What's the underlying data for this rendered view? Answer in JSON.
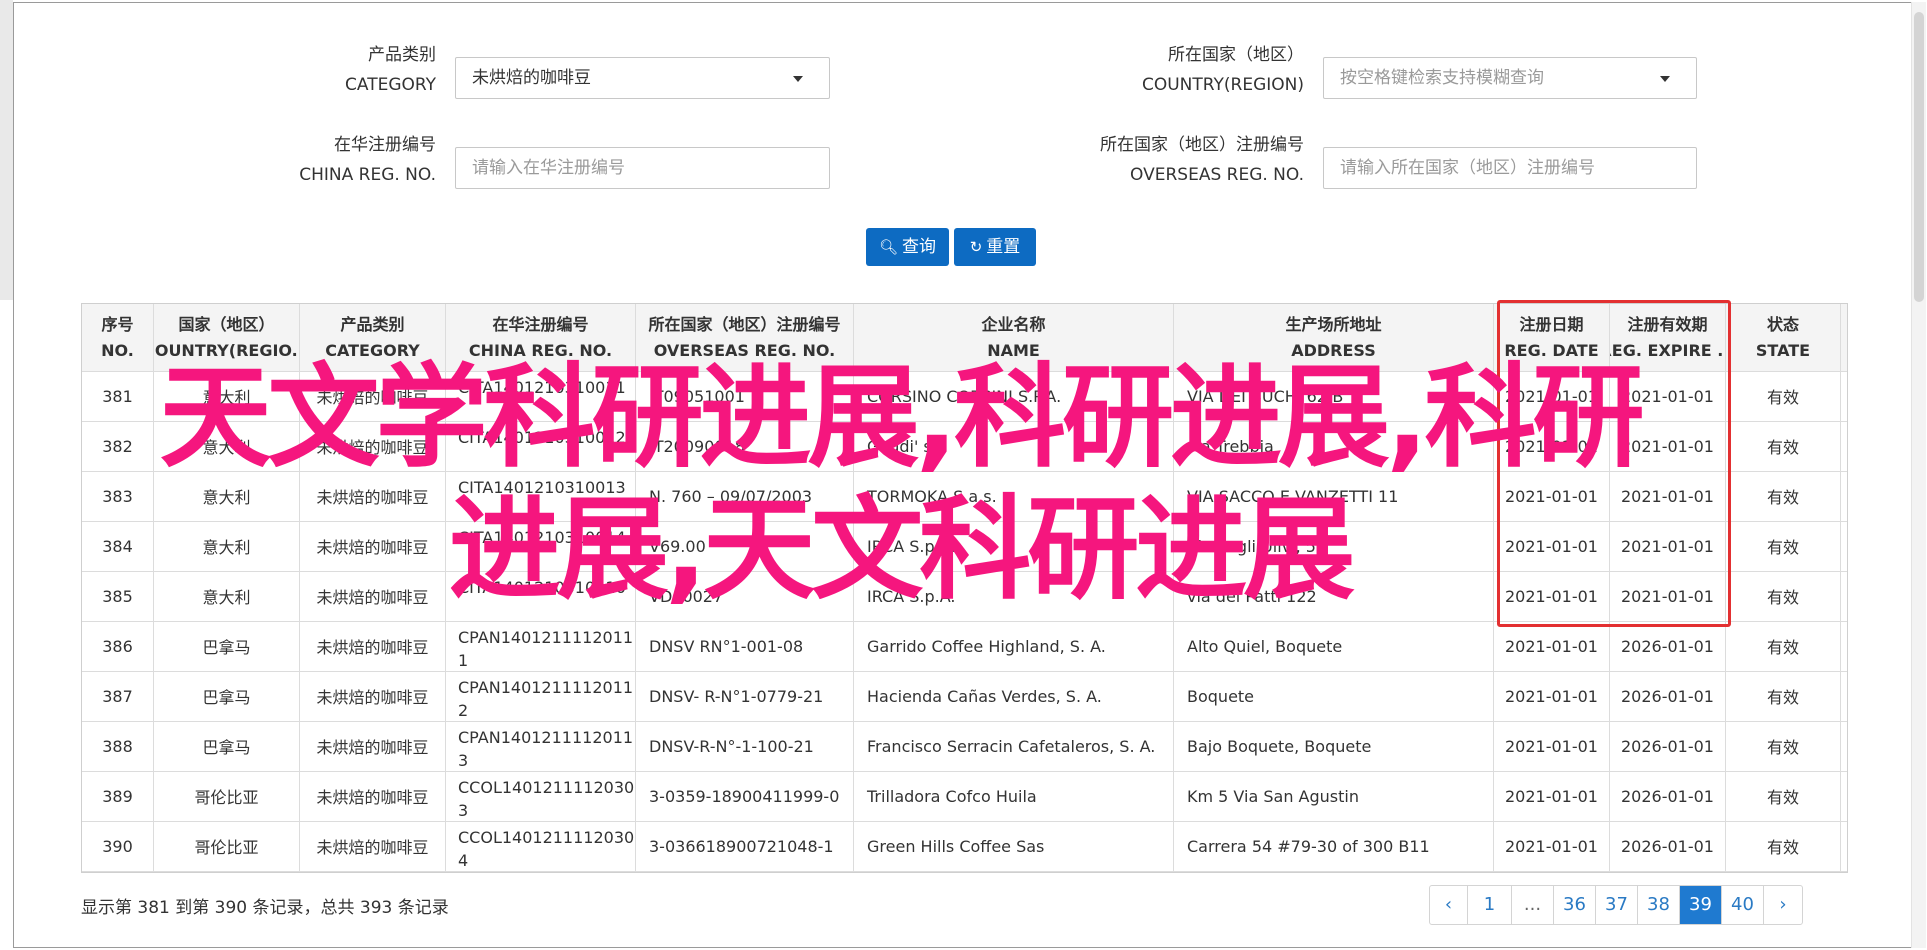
{
  "filters": {
    "category": {
      "label_cn": "产品类别",
      "label_en": "CATEGORY",
      "value": "未烘焙的咖啡豆"
    },
    "country": {
      "label_cn": "所在国家（地区）",
      "label_en": "COUNTRY(REGION)",
      "placeholder": "按空格键检索支持模糊查询"
    },
    "china_reg": {
      "label_cn": "在华注册编号",
      "label_en": "CHINA REG. NO.",
      "placeholder": "请输入在华注册编号"
    },
    "overseas_reg": {
      "label_cn": "所在国家（地区）注册编号",
      "label_en": "OVERSEAS REG. NO.",
      "placeholder": "请输入所在国家（地区）注册编号"
    },
    "search_button": "查询",
    "reset_button": "重置"
  },
  "table": {
    "headers": [
      {
        "cn": "序号",
        "en": "NO."
      },
      {
        "cn": "国家（地区）",
        "en": "COUNTRY(REGIO..."
      },
      {
        "cn": "产品类别",
        "en": "CATEGORY"
      },
      {
        "cn": "在华注册编号",
        "en": "CHINA REG. NO."
      },
      {
        "cn": "所在国家（地区）注册编号",
        "en": "OVERSEAS REG. NO."
      },
      {
        "cn": "企业名称",
        "en": "NAME"
      },
      {
        "cn": "生产场所地址",
        "en": "ADDRESS"
      },
      {
        "cn": "注册日期",
        "en": "REG. DATE"
      },
      {
        "cn": "注册有效期",
        "en": "REG. EXPIRE ..."
      },
      {
        "cn": "状态",
        "en": "STATE"
      }
    ],
    "rows": [
      {
        "no": "381",
        "country": "意大利",
        "category": "未烘焙的咖啡豆",
        "china_reg": "CITA1401210310011",
        "overseas_reg": "IT09051001",
        "name": "CORSINO CORSINI S.P.A.",
        "address": "VIA DEI BUCHI 62/B",
        "reg_date": "2021-01-01",
        "expire": "2021-01-01",
        "state": "有效"
      },
      {
        "no": "382",
        "country": "意大利",
        "category": "未烘焙的咖啡豆",
        "china_reg": "CITA1401210310012",
        "overseas_reg": "IT20090018",
        "name": "Gaudi' srl",
        "address": "via Trebbia",
        "reg_date": "2021-01-01",
        "expire": "2021-01-01",
        "state": "有效"
      },
      {
        "no": "383",
        "country": "意大利",
        "category": "未烘焙的咖啡豆",
        "china_reg": "CITA1401210310013",
        "overseas_reg": "N. 760 – 09/07/2003",
        "name": "TORMOKA S.a.s.",
        "address": "VIA SACCO E VANZETTI 11",
        "reg_date": "2021-01-01",
        "expire": "2021-01-01",
        "state": "有效"
      },
      {
        "no": "384",
        "country": "意大利",
        "category": "未烘焙的咖啡豆",
        "china_reg": "CITA1401210310014",
        "overseas_reg": "V69.00",
        "name": "IRCA S.p.A.",
        "address": "Via degli Ulivi, 5",
        "reg_date": "2021-01-01",
        "expire": "2021-01-01",
        "state": "有效"
      },
      {
        "no": "385",
        "country": "意大利",
        "category": "未烘焙的咖啡豆",
        "china_reg": "CITA1401210310016",
        "overseas_reg": "VD00027",
        "name": "IRCA S.p.A.",
        "address": "via dei Patti 122",
        "reg_date": "2021-01-01",
        "expire": "2021-01-01",
        "state": "有效"
      },
      {
        "no": "386",
        "country": "巴拿马",
        "category": "未烘焙的咖啡豆",
        "china_reg": "CPAN14012111120111",
        "overseas_reg": "DNSV RN°1-001-08",
        "name": "Garrido Coffee Highland, S. A.",
        "address": "Alto Quiel, Boquete",
        "reg_date": "2021-01-01",
        "expire": "2026-01-01",
        "state": "有效"
      },
      {
        "no": "387",
        "country": "巴拿马",
        "category": "未烘焙的咖啡豆",
        "china_reg": "CPAN14012111120112",
        "overseas_reg": "DNSV- R-N°1-0779-21",
        "name": "Hacienda Cañas Verdes, S. A.",
        "address": "Boquete",
        "reg_date": "2021-01-01",
        "expire": "2026-01-01",
        "state": "有效"
      },
      {
        "no": "388",
        "country": "巴拿马",
        "category": "未烘焙的咖啡豆",
        "china_reg": "CPAN14012111120113",
        "overseas_reg": "DNSV-R-N°-1-100-21",
        "name": "Francisco Serracin Cafetaleros, S. A.",
        "address": "Bajo Boquete, Boquete",
        "reg_date": "2021-01-01",
        "expire": "2026-01-01",
        "state": "有效"
      },
      {
        "no": "389",
        "country": "哥伦比亚",
        "category": "未烘焙的咖啡豆",
        "china_reg": "CCOL14012111120303",
        "overseas_reg": "3-0359-18900411999-0",
        "name": "Trilladora Cofco Huila",
        "address": "Km 5 Via San Agustin",
        "reg_date": "2021-01-01",
        "expire": "2026-01-01",
        "state": "有效"
      },
      {
        "no": "390",
        "country": "哥伦比亚",
        "category": "未烘焙的咖啡豆",
        "china_reg": "CCOL14012111120304",
        "overseas_reg": "3-036618900721048-1",
        "name": "Green Hills Coffee Sas",
        "address": "Carrera 54 #79-30 of 300 B11",
        "reg_date": "2021-01-01",
        "expire": "2026-01-01",
        "state": "有效"
      }
    ]
  },
  "overlay_text": "天文学科研进展,科研进展,科研进展,天文科研进展",
  "overlay_lines": [
    "天文学科研进展,科研进展,科研",
    "进展,天文科研进展"
  ],
  "footer": {
    "summary": "显示第 381 到第 390 条记录，总共 393 条记录",
    "pages": [
      "‹",
      "1",
      "...",
      "36",
      "37",
      "38",
      "39",
      "40",
      "›"
    ],
    "active_page": "39"
  },
  "colors": {
    "accent": "#0d6bc2",
    "highlight_border": "#e33031",
    "overlay": "#f5167e",
    "active_page": "#1f7ad0"
  }
}
